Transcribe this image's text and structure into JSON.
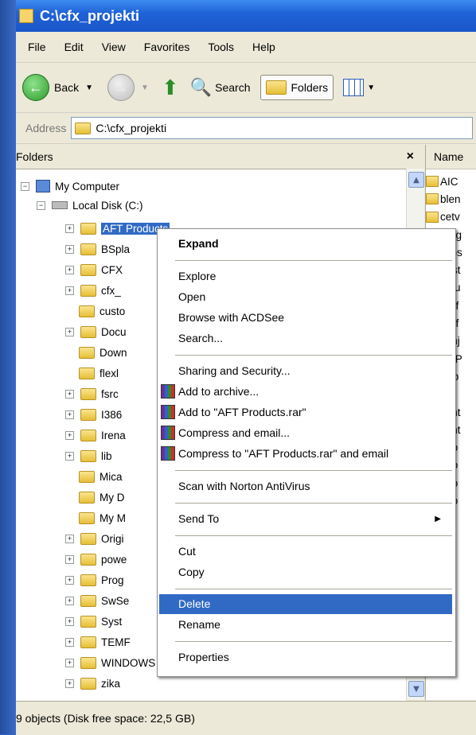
{
  "title": "C:\\cfx_projekti",
  "menu": [
    "File",
    "Edit",
    "View",
    "Favorites",
    "Tools",
    "Help"
  ],
  "toolbar": {
    "back": "Back",
    "search": "Search",
    "folders": "Folders"
  },
  "address": {
    "label": "Address",
    "value": "C:\\cfx_projekti"
  },
  "folders_pane": {
    "title": "Folders",
    "close": "×"
  },
  "tree": {
    "my_computer": "My Computer",
    "local_disk": "Local Disk (C:)",
    "items": [
      "AFT Products",
      "BSpla",
      "CFX",
      "cfx_",
      "custo",
      "Docu",
      "Down",
      "flexl",
      "fsrc",
      "I386",
      "Irena",
      "lib",
      "Mica",
      "My D",
      "My M",
      "Origi",
      "powe",
      "Prog",
      "SwSe",
      "Syst",
      "TEMF",
      "WINDOWS",
      "zika"
    ]
  },
  "files": {
    "header": "Name",
    "items": [
      "AIC",
      "blen",
      "cetv",
      "drag",
      "elips",
      "obst",
      "polu",
      "prof",
      "prof",
      "sanj",
      "SCP",
      "turb",
      "UV",
      "vent",
      "vent",
      "auto",
      "auto",
      "auto",
      "auto"
    ]
  },
  "context_menu": {
    "expand": "Expand",
    "explore": "Explore",
    "open": "Open",
    "browse_acdsee": "Browse with ACDSee",
    "search": "Search...",
    "sharing": "Sharing and Security...",
    "add_archive": "Add to archive...",
    "add_rar": "Add to \"AFT Products.rar\"",
    "compress_email": "Compress and email...",
    "compress_rar_email": "Compress to \"AFT Products.rar\" and email",
    "norton": "Scan with Norton AntiVirus",
    "send_to": "Send To",
    "cut": "Cut",
    "copy": "Copy",
    "delete": "Delete",
    "rename": "Rename",
    "properties": "Properties"
  },
  "status": "9 objects (Disk free space: 22,5 GB)"
}
